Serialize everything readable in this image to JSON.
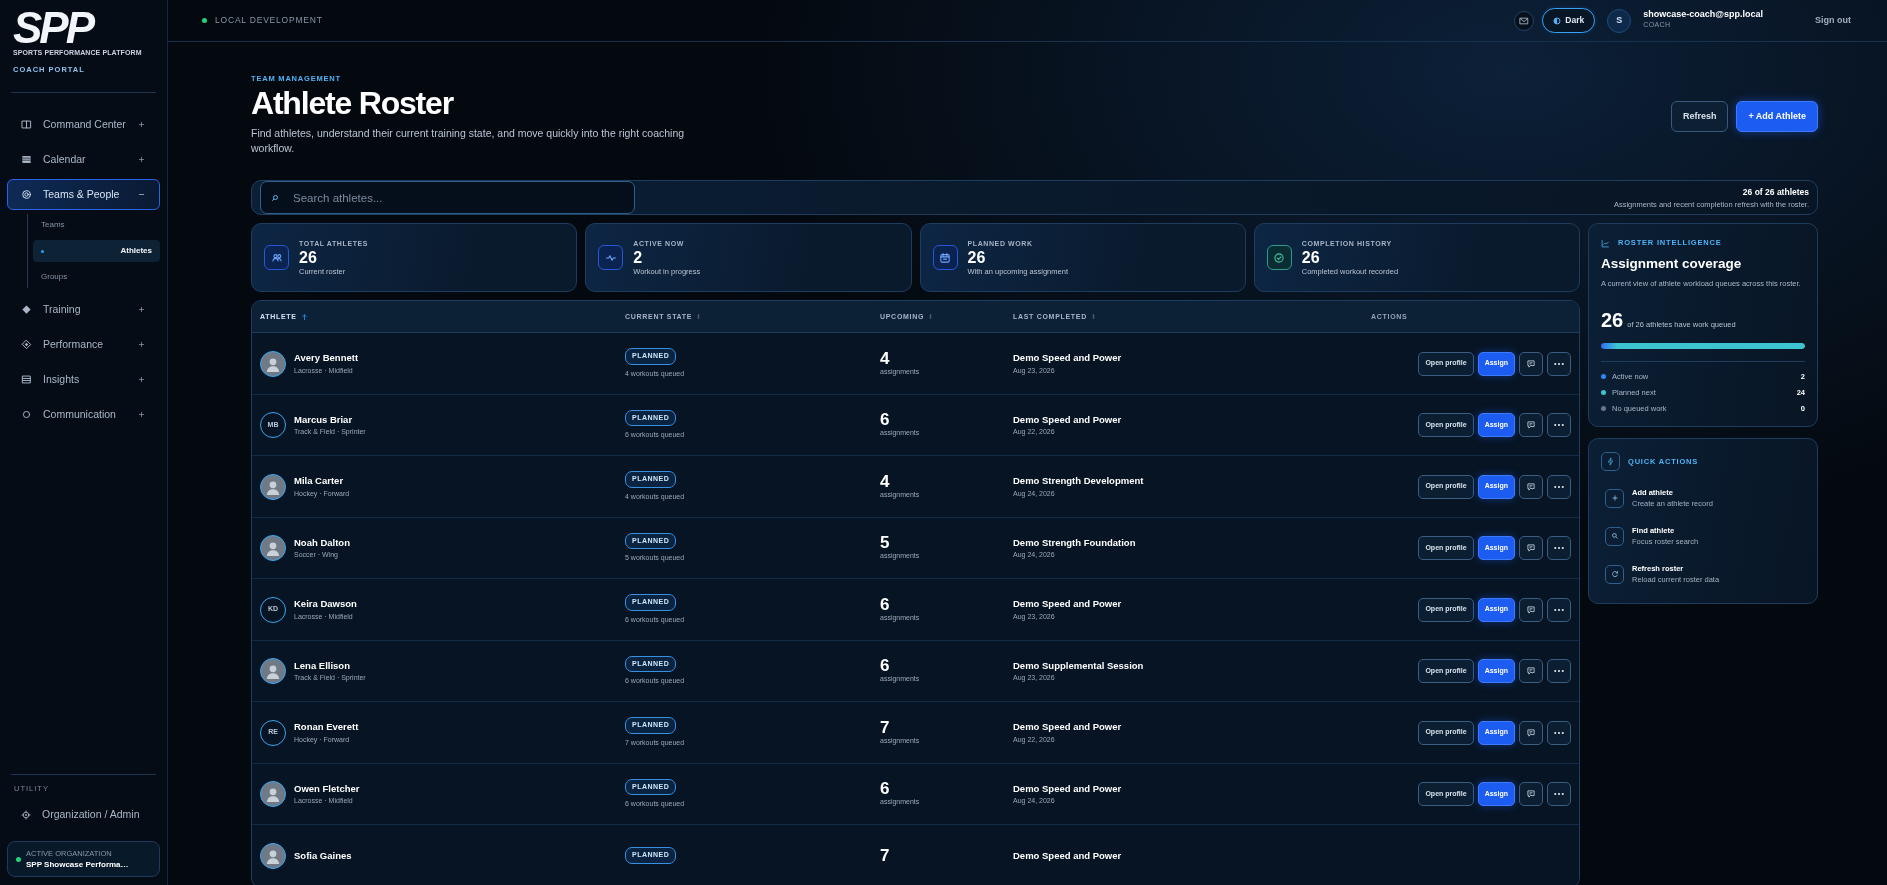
{
  "sidebar": {
    "logo": "SPP",
    "logo_tagline": "SPORTS PERFORMANCE PLATFORM",
    "portal": "COACH PORTAL",
    "nav": [
      {
        "label": "Command Center",
        "selected": false,
        "expanded": false
      },
      {
        "label": "Calendar",
        "selected": false,
        "expanded": false
      },
      {
        "label": "Teams & People",
        "selected": true,
        "expanded": true,
        "children": [
          {
            "label": "Teams",
            "selected": false
          },
          {
            "label": "Athletes",
            "selected": true
          },
          {
            "label": "Groups",
            "selected": false
          }
        ]
      },
      {
        "label": "Training",
        "selected": false,
        "expanded": false
      },
      {
        "label": "Performance",
        "selected": false,
        "expanded": false
      },
      {
        "label": "Insights",
        "selected": false,
        "expanded": false
      },
      {
        "label": "Communication",
        "selected": false,
        "expanded": false
      }
    ],
    "utility_heading": "UTILITY",
    "utility": [
      {
        "label": "Organization / Admin"
      }
    ],
    "active_org": {
      "label": "ACTIVE ORGANIZATION",
      "name": "SPP Showcase Performa…"
    }
  },
  "header": {
    "environment": "LOCAL DEVELOPMENT",
    "theme_toggle": "Dark",
    "user": {
      "initial": "S",
      "email": "showcase-coach@spp.local",
      "role": "COACH"
    },
    "sign_out": "Sign out"
  },
  "page": {
    "eyebrow": "TEAM MANAGEMENT",
    "title": "Athlete Roster",
    "description": "Find athletes, understand their current training state, and move quickly into the right coaching workflow.",
    "buttons": [
      {
        "label": "Refresh",
        "kind": "secondary"
      },
      {
        "label": "+ Add Athlete",
        "kind": "primary"
      }
    ]
  },
  "search": {
    "placeholder": "Search athletes...",
    "count": "26 of 26 athletes",
    "note": "Assignments and recent completion refresh with the roster."
  },
  "stats": [
    {
      "label": "TOTAL ATHLETES",
      "value": "26",
      "caption": "Current roster"
    },
    {
      "label": "ACTIVE NOW",
      "value": "2",
      "caption": "Workout in progress"
    },
    {
      "label": "PLANNED WORK",
      "value": "26",
      "caption": "With an upcoming assignment"
    },
    {
      "label": "COMPLETION HISTORY",
      "value": "26",
      "caption": "Completed workout recorded"
    }
  ],
  "table": {
    "columns": [
      {
        "label": "ATHLETE",
        "sortable": true,
        "sorted": true
      },
      {
        "label": "CURRENT STATE",
        "sortable": true,
        "sorted": false
      },
      {
        "label": "UPCOMING",
        "sortable": true,
        "sorted": false
      },
      {
        "label": "LAST COMPLETED",
        "sortable": true,
        "sorted": false
      },
      {
        "label": "ACTIONS",
        "sortable": false,
        "sorted": false
      }
    ],
    "rows": [
      {
        "photo": true,
        "name": "Avery Bennett",
        "sport": "Lacrosse · Midfield",
        "state": "PLANNED",
        "queue": "4 workouts queued",
        "upcoming": "4",
        "upcoming_label": "assignments",
        "last_title": "Demo Speed and Power",
        "last_date": "Aug 23, 2026",
        "actions": [
          "Open profile",
          "Assign"
        ]
      },
      {
        "photo": false,
        "initials": "MB",
        "name": "Marcus Briar",
        "sport": "Track & Field · Sprinter",
        "state": "PLANNED",
        "queue": "6 workouts queued",
        "upcoming": "6",
        "upcoming_label": "assignments",
        "last_title": "Demo Speed and Power",
        "last_date": "Aug 22, 2026",
        "actions": [
          "Open profile",
          "Assign"
        ]
      },
      {
        "photo": true,
        "name": "Mila Carter",
        "sport": "Hockey · Forward",
        "state": "PLANNED",
        "queue": "4 workouts queued",
        "upcoming": "4",
        "upcoming_label": "assignments",
        "last_title": "Demo Strength Development",
        "last_date": "Aug 24, 2026",
        "actions": [
          "Open profile",
          "Assign"
        ]
      },
      {
        "photo": true,
        "name": "Noah Dalton",
        "sport": "Soccer · Wing",
        "state": "PLANNED",
        "queue": "5 workouts queued",
        "upcoming": "5",
        "upcoming_label": "assignments",
        "last_title": "Demo Strength Foundation",
        "last_date": "Aug 24, 2026",
        "actions": [
          "Open profile",
          "Assign"
        ]
      },
      {
        "photo": false,
        "initials": "KD",
        "name": "Keira Dawson",
        "sport": "Lacrosse · Midfield",
        "state": "PLANNED",
        "queue": "6 workouts queued",
        "upcoming": "6",
        "upcoming_label": "assignments",
        "last_title": "Demo Speed and Power",
        "last_date": "Aug 23, 2026",
        "actions": [
          "Open profile",
          "Assign"
        ]
      },
      {
        "photo": true,
        "name": "Lena Ellison",
        "sport": "Track & Field · Sprinter",
        "state": "PLANNED",
        "queue": "6 workouts queued",
        "upcoming": "6",
        "upcoming_label": "assignments",
        "last_title": "Demo Supplemental Session",
        "last_date": "Aug 23, 2026",
        "actions": [
          "Open profile",
          "Assign"
        ]
      },
      {
        "photo": false,
        "initials": "RE",
        "name": "Ronan Everett",
        "sport": "Hockey · Forward",
        "state": "PLANNED",
        "queue": "7 workouts queued",
        "upcoming": "7",
        "upcoming_label": "assignments",
        "last_title": "Demo Speed and Power",
        "last_date": "Aug 22, 2026",
        "actions": [
          "Open profile",
          "Assign"
        ]
      },
      {
        "photo": true,
        "name": "Owen Fletcher",
        "sport": "Lacrosse · Midfield",
        "state": "PLANNED",
        "queue": "6 workouts queued",
        "upcoming": "6",
        "upcoming_label": "assignments",
        "last_title": "Demo Speed and Power",
        "last_date": "Aug 24, 2026",
        "actions": [
          "Open profile",
          "Assign"
        ]
      },
      {
        "photo": true,
        "name": "Sofia Gaines",
        "state": "PLANNED",
        "upcoming": "7",
        "last_title": "Demo Speed and Power"
      }
    ]
  },
  "coverage": {
    "eyebrow": "ROSTER INTELLIGENCE",
    "title": "Assignment coverage",
    "description": "A current view of athlete workload queues across this roster.",
    "value": "26",
    "caption": "of 26 athletes have work queued",
    "level": 1.0,
    "legend": [
      {
        "label": "Active now",
        "value": "2",
        "color": "#2f86f6"
      },
      {
        "label": "Planned next",
        "value": "24",
        "color": "#3cc4d0"
      },
      {
        "label": "No queued work",
        "value": "0",
        "color": "#6b7688"
      }
    ]
  },
  "quick_actions": {
    "heading": "QUICK ACTIONS",
    "items": [
      {
        "title": "Add athlete",
        "caption": "Create an athlete record"
      },
      {
        "title": "Find athlete",
        "caption": "Focus roster search"
      },
      {
        "title": "Refresh roster",
        "caption": "Reload current roster data"
      }
    ]
  }
}
